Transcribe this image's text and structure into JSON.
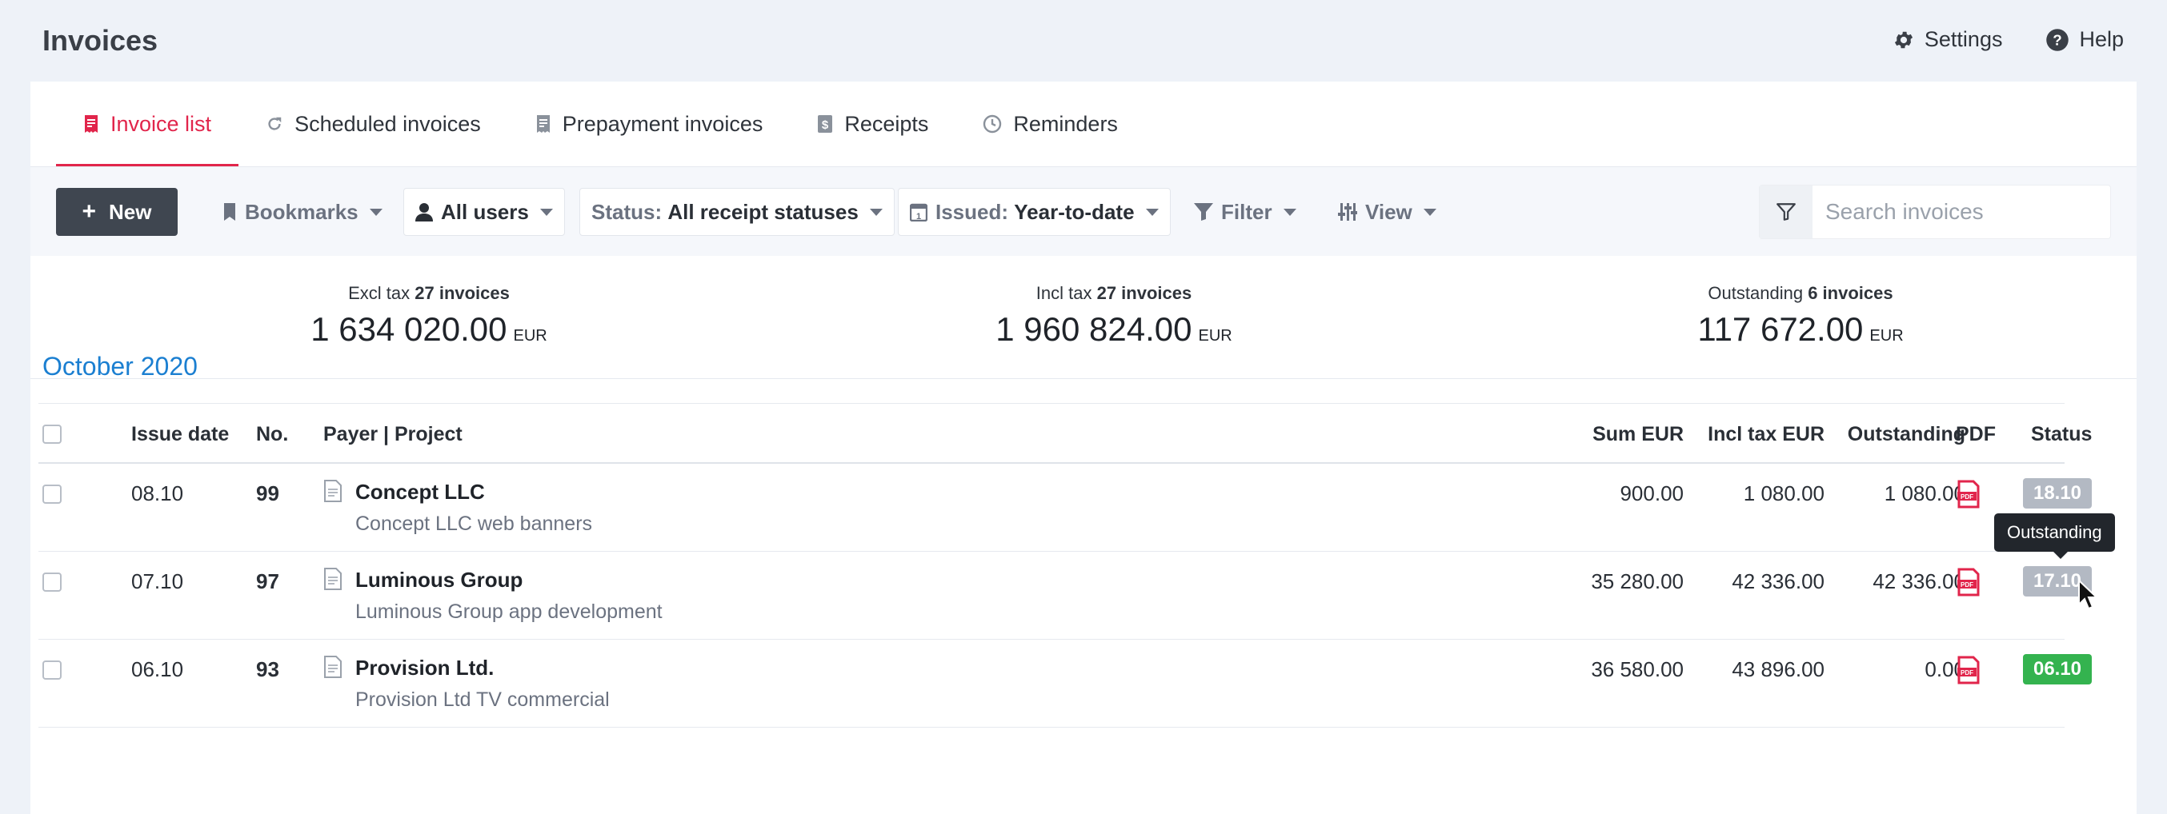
{
  "header": {
    "title": "Invoices",
    "settings_label": "Settings",
    "help_label": "Help"
  },
  "tabs": [
    {
      "label": "Invoice list",
      "icon": "receipt-icon",
      "active": true
    },
    {
      "label": "Scheduled invoices",
      "icon": "refresh-icon"
    },
    {
      "label": "Prepayment invoices",
      "icon": "receipt-icon"
    },
    {
      "label": "Receipts",
      "icon": "dollar-doc-icon"
    },
    {
      "label": "Reminders",
      "icon": "clock-icon"
    }
  ],
  "toolbar": {
    "new_label": "New",
    "bookmarks_label": "Bookmarks",
    "users_label": "All users",
    "status_prefix": "Status:",
    "status_value": "All receipt statuses",
    "issued_prefix": "Issued:",
    "issued_value": "Year-to-date",
    "filter_label": "Filter",
    "view_label": "View",
    "search_placeholder": "Search invoices"
  },
  "summary": [
    {
      "label": "Excl tax",
      "count": "27 invoices",
      "value": "1 634 020.00",
      "currency": "EUR"
    },
    {
      "label": "Incl tax",
      "count": "27 invoices",
      "value": "1 960 824.00",
      "currency": "EUR"
    },
    {
      "label": "Outstanding",
      "count": "6 invoices",
      "value": "117 672.00",
      "currency": "EUR"
    }
  ],
  "month": "October 2020",
  "columns": {
    "issue_date": "Issue date",
    "no": "No.",
    "payer": "Payer | Project",
    "sum": "Sum EUR",
    "incl_tax": "Incl tax EUR",
    "outstanding": "Outstanding",
    "pdf": "PDF",
    "status": "Status"
  },
  "rows": [
    {
      "date": "08.10",
      "no": "99",
      "payer": "Concept LLC",
      "project": "Concept LLC web banners",
      "sum": "900.00",
      "incl": "1 080.00",
      "outstanding": "1 080.00",
      "status": "18.10",
      "status_color": "#b3b9c3"
    },
    {
      "date": "07.10",
      "no": "97",
      "payer": "Luminous Group",
      "project": "Luminous Group app development",
      "sum": "35 280.00",
      "incl": "42 336.00",
      "outstanding": "42 336.00",
      "status": "17.10",
      "status_color": "#b3b9c3"
    },
    {
      "date": "06.10",
      "no": "93",
      "payer": "Provision Ltd.",
      "project": "Provision Ltd TV commercial",
      "sum": "36 580.00",
      "incl": "43 896.00",
      "outstanding": "0.00",
      "status": "06.10",
      "status_color": "#34b34f"
    }
  ],
  "tooltip": "Outstanding",
  "colors": {
    "accent": "#e1254b",
    "link": "#1b7fd1",
    "dark_button": "#3f4650"
  }
}
